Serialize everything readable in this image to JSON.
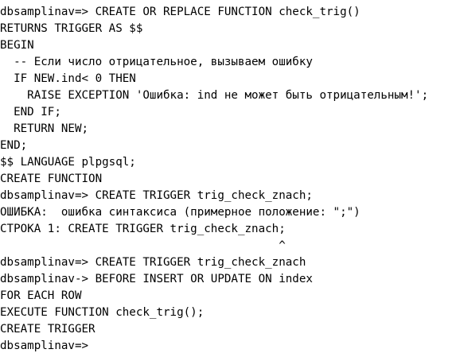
{
  "terminal": {
    "lines": [
      "dbsamplinav=> CREATE OR REPLACE FUNCTION check_trig()",
      "RETURNS TRIGGER AS $$",
      "BEGIN",
      "  -- Если число отрицательное, вызываем ошибку",
      "  IF NEW.ind< 0 THEN",
      "    RAISE EXCEPTION 'Ошибка: ind не может быть отрицательным!';",
      "  END IF;",
      "  RETURN NEW;",
      "END;",
      "$$ LANGUAGE plpgsql;",
      "CREATE FUNCTION",
      "dbsamplinav=> CREATE TRIGGER trig_check_znach;",
      "ОШИБКА:  ошибка синтаксиса (примерное положение: \";\")",
      "СТРОКА 1: CREATE TRIGGER trig_check_znach;",
      "                                         ^",
      "dbsamplinav=> CREATE TRIGGER trig_check_znach",
      "dbsamplinav-> BEFORE INSERT OR UPDATE ON index",
      "FOR EACH ROW",
      "EXECUTE FUNCTION check_trig();",
      "CREATE TRIGGER",
      "dbsamplinav=>"
    ]
  }
}
